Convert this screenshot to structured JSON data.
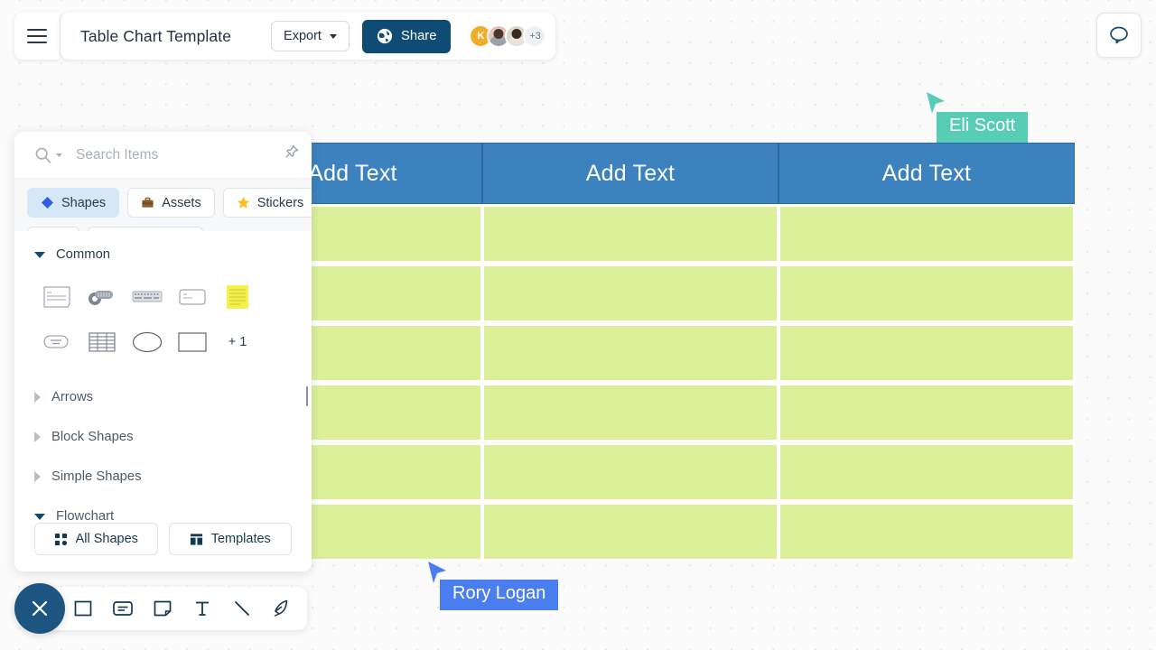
{
  "app": {
    "document_title": "Table Chart Template",
    "menu_icon": "hamburger-icon",
    "comment_icon": "comment-bubble-icon"
  },
  "toolbar": {
    "export_label": "Export",
    "export_caret_icon": "chevron-down-icon",
    "share_label": "Share",
    "share_icon": "globe-icon",
    "share_bg": "#0f4c75",
    "avatars": [
      {
        "name": "avatar-k",
        "initial": "K",
        "type": "initial",
        "color": "#f0ad2a"
      },
      {
        "name": "avatar-photo-1",
        "initial": "",
        "type": "photo",
        "color": "#e9c3bd"
      },
      {
        "name": "avatar-photo-2",
        "initial": "",
        "type": "photo",
        "color": "#d8d9c8"
      }
    ],
    "avatar_overflow": "+3"
  },
  "shapes_panel": {
    "search": {
      "placeholder": "Search Items",
      "value": "",
      "icon": "search-icon",
      "dropdown_icon": "caret-down-icon"
    },
    "pin_icon": "pin-icon",
    "tabs": [
      {
        "label": "Shapes",
        "icon": "blue-diamond-icon",
        "active": true
      },
      {
        "label": "Assets",
        "icon": "briefcase-icon",
        "active": false
      },
      {
        "label": "Stickers",
        "icon": "star-icon",
        "active": false
      }
    ],
    "groups": [
      {
        "label": "Common",
        "expanded": true
      },
      {
        "label": "Arrows",
        "expanded": false
      },
      {
        "label": "Block Shapes",
        "expanded": false
      },
      {
        "label": "Simple Shapes",
        "expanded": false
      },
      {
        "label": "Flowchart",
        "expanded": true
      }
    ],
    "common_shapes_row1": [
      "card-shape",
      "tape-shape",
      "keyboard-shape",
      "rounded-card-shape",
      "sticky-note-shape",
      "rounded-label-shape"
    ],
    "common_shapes_row2": [
      "table-shape",
      "ellipse-shape",
      "rectangle-shape"
    ],
    "more_shapes_label": "+ 1",
    "footer": {
      "all_shapes_label": "All Shapes",
      "all_shapes_icon": "grid-dots-icon",
      "templates_label": "Templates",
      "templates_icon": "layout-icon"
    }
  },
  "bottom_toolbar": {
    "close_icon": "close-x-icon",
    "tools": [
      {
        "name": "shape-tool",
        "icon": "square-icon"
      },
      {
        "name": "card-tool",
        "icon": "card-icon"
      },
      {
        "name": "note-tool",
        "icon": "note-icon"
      },
      {
        "name": "text-tool",
        "icon": "text-t-icon"
      },
      {
        "name": "line-tool",
        "icon": "diagonal-line-icon"
      },
      {
        "name": "pen-tool",
        "icon": "pen-nib-icon"
      }
    ]
  },
  "canvas": {
    "table": {
      "headers": [
        "Add Text",
        "Add Text",
        "Add Text"
      ],
      "header_bg": "#3b82bf",
      "cell_bg": "#dcf09a",
      "row_count": 6,
      "rows": [
        [
          "",
          "",
          ""
        ],
        [
          "",
          "",
          ""
        ],
        [
          "",
          "",
          ""
        ],
        [
          "",
          "",
          ""
        ],
        [
          "",
          "",
          ""
        ],
        [
          "",
          "",
          ""
        ]
      ]
    },
    "collaborators": [
      {
        "name": "Eli Scott",
        "color": "#56cdb4"
      },
      {
        "name": "Rory Logan",
        "color": "#4a7ef0"
      }
    ]
  }
}
